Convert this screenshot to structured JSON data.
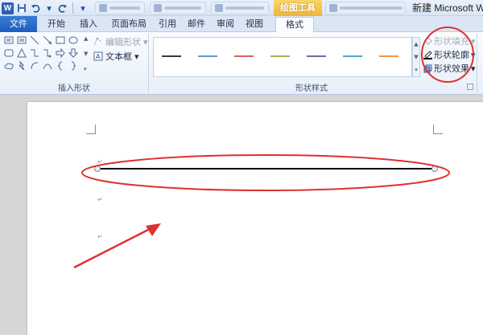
{
  "title_bar": {
    "app_title": "新建 Microsoft Wo",
    "context_tab_group": "绘图工具"
  },
  "ribbon_tabs": [
    "文件",
    "开始",
    "插入",
    "页面布局",
    "引用",
    "邮件",
    "审阅",
    "视图",
    "格式"
  ],
  "active_tab": "格式",
  "insert_shapes_group": {
    "label": "插入形状",
    "edit_shape": "编辑形状",
    "text_box": "文本框"
  },
  "shape_styles_group": {
    "label": "形状样式",
    "line_colors": [
      "#3a3a3a",
      "#5b9bd5",
      "#e0605c",
      "#9bbb59",
      "#8064a2",
      "#4bacc6",
      "#f79646"
    ]
  },
  "shape_commands": {
    "fill": "形状填充",
    "outline": "形状轮廓",
    "effects": "形状效果"
  },
  "annotations": {
    "circle_color": "#e03030",
    "arrow_color": "#e03030"
  }
}
